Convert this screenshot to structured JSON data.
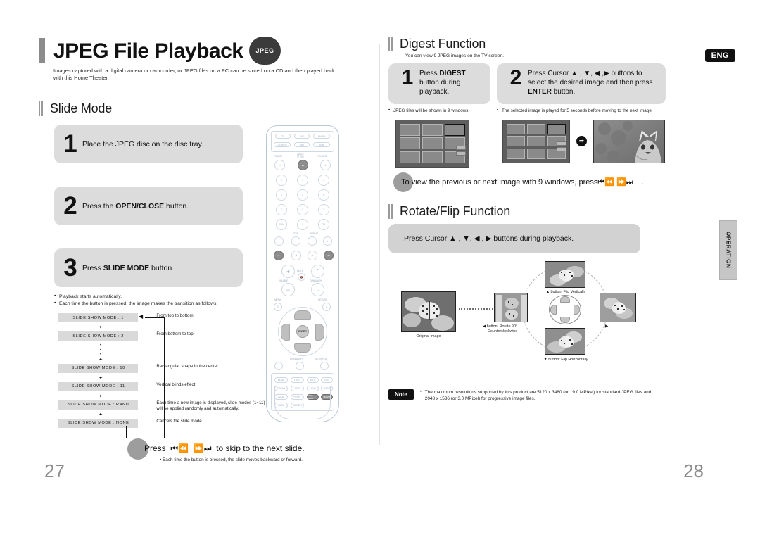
{
  "document": {
    "eng_badge": "ENG",
    "side_tab": "OPERATION",
    "page_left": "27",
    "page_right": "28"
  },
  "left": {
    "title": "JPEG File Playback",
    "title_badge": "JPEG",
    "subtitle": "Images captured with a digital camera or camcorder, or JPEG files on a PC can be stored on a CD and then played back with this Home Theater.",
    "section": "Slide Mode",
    "steps": [
      {
        "num": "1",
        "text_pre": "Place the JPEG disc on the disc tray.",
        "bold": "",
        "text_post": ""
      },
      {
        "num": "2",
        "text_pre": "Press the ",
        "bold": "OPEN/CLOSE",
        "text_post": " button."
      },
      {
        "num": "3",
        "text_pre": "Press ",
        "bold": "SLIDE MODE",
        "text_post": " button."
      }
    ],
    "bullets": [
      "Playback starts automatically.",
      "Each time the button is pressed, the image makes the transition as follows:"
    ],
    "flow": [
      {
        "chip": "SLIDE SHOW MODE : 1",
        "desc": "From top to bottom"
      },
      {
        "chip": "SLIDE SHOW MODE : 2",
        "desc": "From bottom to top"
      },
      {
        "chip": "SLIDE SHOW MODE : 10",
        "desc": "Rectangular shape in the center"
      },
      {
        "chip": "SLIDE SHOW MODE : 11",
        "desc": "Vertical blinds effect"
      },
      {
        "chip": "SLIDE SHOW MODE : RAND",
        "desc": "Each time a new image is displayed, slide modes (1~11) will be applied randomly and automatically."
      },
      {
        "chip": "SLIDE SHOW MODE : NONE",
        "desc": "Cancels the slide mode."
      }
    ],
    "press_line": "Press ⏮ ⏭  to skip to the next slide.",
    "press_prefix": "Press",
    "press_icons": " ⏮⏪  ⏩⏭ ",
    "press_suffix": "to skip to the next slide.",
    "press_sub": "Each time the button is pressed, the slide moves backward or forward."
  },
  "right": {
    "digest": {
      "section": "Digest Function",
      "note": "You can view 9 JPEG images on the TV screen.",
      "steps": [
        {
          "num": "1",
          "pre": "Press ",
          "bold": "DIGEST",
          "post": " button during playback."
        },
        {
          "num": "2",
          "pre": "Press Cursor ▲ , ▼, ◀ ,▶ buttons to select the desired image and then press ",
          "bold": "ENTER",
          "post": " button."
        }
      ],
      "bullets": [
        "JPEG files will be shown in 9 windows.",
        "The selected image is played for 5 seconds before moving to the next image."
      ],
      "tip_prefix": "To view the previous or next image with 9 windows, press",
      "tip_icons": "⏮⏪ ⏩⏭",
      "tip_suffix": "."
    },
    "rotate": {
      "section": "Rotate/Flip Function",
      "panel_text": "Press Cursor ▲ , ▼, ◀ , ▶  buttons during playback.",
      "original_label": "Original Image",
      "labels": {
        "up": "▲ button: Flip Vertically",
        "down": "▼ button: Flip Horizontally",
        "left_line1": "◀ button: Rotate 90°",
        "left_line2": "Counterclockwise"
      }
    },
    "note": {
      "tag": "Note",
      "text": "The maximum resolutions supported by this product are 5120 x 3480 (or 19.0 MPixel) for standard JPEG files and 2048 x 1536 (or 3.0 MPixel) for progressive image files."
    }
  },
  "remote": {
    "source_keys": [
      "TV",
      "DVD",
      "FM/AM"
    ],
    "source_keys2": [
      "SCREEN",
      "AUX",
      "USB"
    ],
    "labels": {
      "power": "POWER",
      "open_close": "OPEN/ CLOSE",
      "tv_video": "TV/VIDEO",
      "numbers": [
        "1",
        "2",
        "3",
        "4",
        "5",
        "6",
        "7",
        "8",
        "9",
        "0"
      ],
      "remain": "REMAIN",
      "cancel": "CANCEL",
      "step": "STEP",
      "repeat": "REPEAT",
      "menu": "MENU",
      "return": "RETURN",
      "enter": "ENTER",
      "ex_search": "EX.SEARCH",
      "sd_display": "SD DISPLAY",
      "volume": "VOLUME",
      "mute": "MUTE",
      "tuning": "TUNING/CH",
      "slide_mode": "SLIDE MODE",
      "digest": "DIGEST",
      "sleep": "SLEEP",
      "dimmer": "DIMMER",
      "zoom": "ZOOM",
      "p_scan": "P.SCAN",
      "logo": "LOGO",
      "sound_edit": "SOUND EDIT",
      "info": "INFO",
      "test_tone": "TEST TONE"
    }
  }
}
